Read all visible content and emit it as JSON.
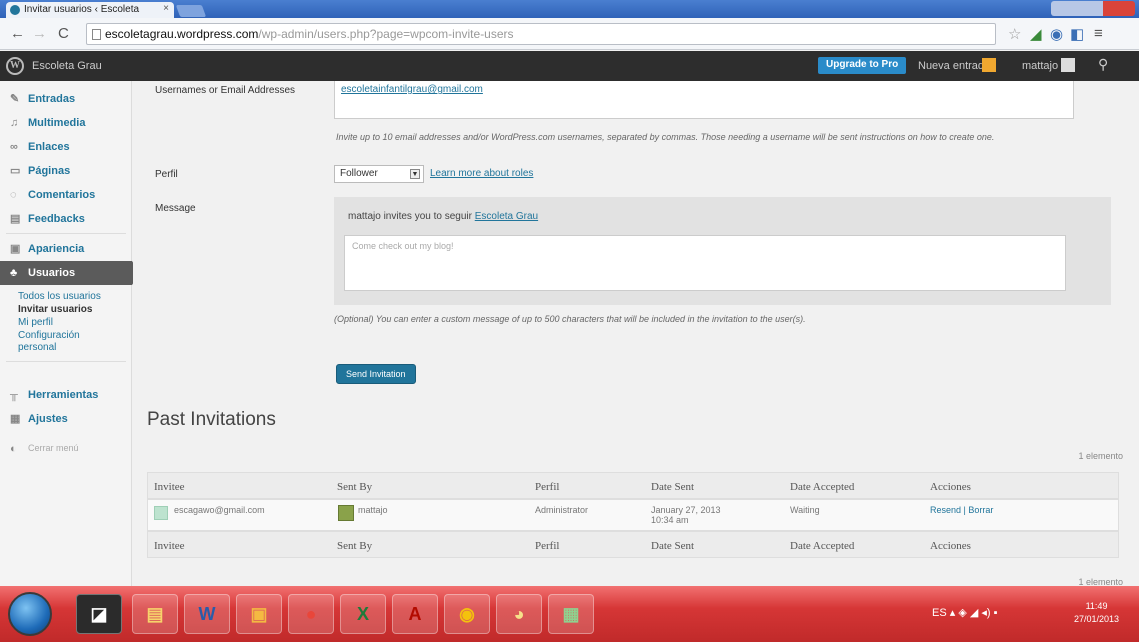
{
  "browser": {
    "tab_title": "Invitar usuarios ‹ Escoleta",
    "tab_close": "×",
    "url_host": "escoletagrau.wordpress.com",
    "url_path": "/wp-admin/users.php?page=wpcom-invite-users"
  },
  "adminbar": {
    "site_name": "Escoleta Grau",
    "upgrade": "Upgrade to Pro",
    "new_post": "Nueva entrada",
    "user": "mattajo"
  },
  "sidebar": {
    "items": [
      {
        "label": "Entradas",
        "icon": "pin-icon"
      },
      {
        "label": "Multimedia",
        "icon": "media-icon"
      },
      {
        "label": "Enlaces",
        "icon": "link-icon"
      },
      {
        "label": "Páginas",
        "icon": "page-icon"
      },
      {
        "label": "Comentarios",
        "icon": "comment-icon"
      },
      {
        "label": "Feedbacks",
        "icon": "feedback-icon"
      },
      {
        "label": "Apariencia",
        "icon": "appearance-icon"
      },
      {
        "label": "Usuarios",
        "icon": "users-icon"
      },
      {
        "label": "Herramientas",
        "icon": "tools-icon"
      },
      {
        "label": "Ajustes",
        "icon": "settings-icon"
      }
    ],
    "submenu": [
      "Todos los usuarios",
      "Invitar usuarios",
      "Mi perfil",
      "Configuración",
      "personal"
    ],
    "collapse": "Cerrar menú"
  },
  "form": {
    "usernames_label": "Usernames or Email Addresses",
    "email_value": "escoletainfantilgrau@gmail.com",
    "invite_hint": "Invite up to 10 email addresses and/or WordPress.com usernames, separated by commas. Those needing a username will be sent instructions on how to create one.",
    "role_label": "Perfil",
    "role_value": "Follower",
    "learn_more": "Learn more about roles",
    "message_label": "Message",
    "message_intro": "mattajo invites you to seguir",
    "message_site": "Escoleta Grau",
    "message_placeholder": "Come check out my blog!",
    "message_hint": "(Optional) You can enter a custom message of up to 500 characters that will be included in the invitation to the user(s).",
    "send_button": "Send Invitation"
  },
  "past": {
    "title": "Past Invitations",
    "count": "1 elemento",
    "columns": [
      "Invitee",
      "Sent By",
      "Perfil",
      "Date Sent",
      "Date Accepted",
      "Acciones"
    ],
    "row": {
      "invitee": "escagawo@gmail.com",
      "sent_by": "mattajo",
      "role": "Administrator",
      "date_sent_1": "January 27, 2013",
      "date_sent_2": "10:34 am",
      "date_accepted": "Waiting",
      "actions": "Resend | Borrar"
    }
  },
  "taskbar": {
    "apps": [
      "word-icon",
      "outlook-icon",
      "chrome-icon",
      "excel-icon",
      "acrobat-icon",
      "chrome-icon",
      "paint-icon",
      "image-icon"
    ],
    "tray": "ES",
    "time": "11:49",
    "date": "27/01/2013"
  }
}
